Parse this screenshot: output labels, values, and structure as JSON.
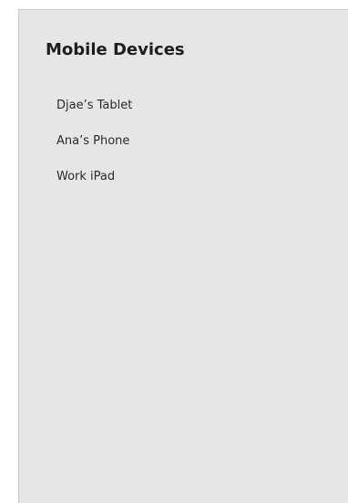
{
  "panel": {
    "title": "Mobile Devices",
    "devices": [
      {
        "label": "Djae’s Tablet"
      },
      {
        "label": "Ana’s Phone"
      },
      {
        "label": "Work iPad"
      }
    ]
  },
  "colors": {
    "panel_background": "#e6e6e6",
    "panel_border": "#c8c8c8",
    "text": "#1e1e1e"
  }
}
